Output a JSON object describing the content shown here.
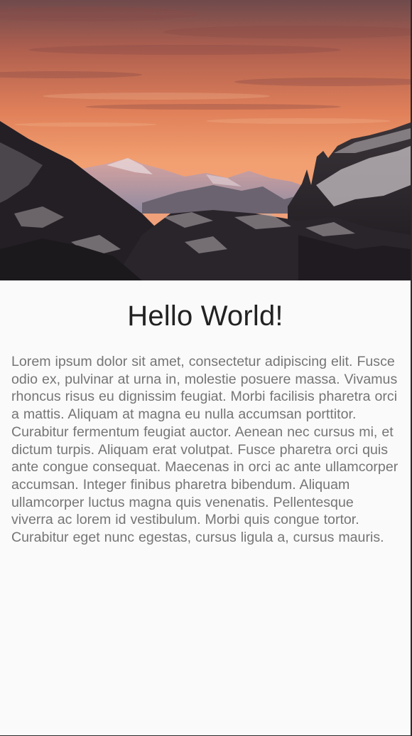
{
  "hero": {
    "image_subject": "sunset-mountains",
    "colors": {
      "sky_top": "#7a4a48",
      "sky_mid": "#e07a54",
      "sky_low": "#f3a777",
      "mountain_dark": "#231f24",
      "snow": "#b9b4b8"
    }
  },
  "main": {
    "title": "Hello World!",
    "body": "Lorem ipsum dolor sit amet, consectetur adipiscing elit. Fusce odio ex, pulvinar at urna in, molestie posuere massa. Vivamus rhoncus risus eu dignissim feugiat. Morbi facilisis pharetra orci a mattis. Aliquam at magna eu nulla accumsan porttitor. Curabitur fermentum feugiat auctor. Aenean nec cursus mi, et dictum turpis. Aliquam erat volutpat. Fusce pharetra orci quis ante congue consequat. Maecenas in orci ac ante ullamcorper accumsan. Integer finibus pharetra bibendum. Aliquam ullamcorper luctus magna quis venenatis. Pellentesque viverra ac lorem id vestibulum. Morbi quis congue tortor. Curabitur eget nunc egestas, cursus ligula a, cursus mauris."
  }
}
